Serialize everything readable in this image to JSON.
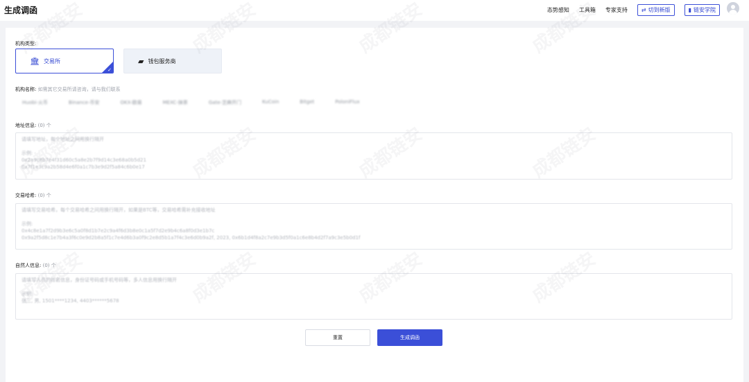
{
  "header": {
    "title": "生成调函",
    "nav": [
      "态势感知",
      "工具箱",
      "专家支持"
    ],
    "pills": [
      {
        "icon": "switch-icon",
        "label": "切到新版"
      },
      {
        "icon": "book-icon",
        "label": "链安学院"
      }
    ]
  },
  "form": {
    "type_label": "机构类型:",
    "type_options": [
      {
        "icon": "bank-icon",
        "label": "交易所",
        "selected": true
      },
      {
        "icon": "wallet-icon",
        "label": "钱包服务商",
        "selected": false
      }
    ],
    "name_label": "机构名称:",
    "name_hint": "如需其它交易所请咨询，请与我们联系",
    "exchanges": [
      "Huobi-火币",
      "Binance-币安",
      "OKX-欧易",
      "MEXC-抹茶",
      "Gate-芝麻开门",
      "KuCoin",
      "Bitget",
      "PoloniFlux"
    ],
    "address": {
      "label": "地址信息:",
      "count": "(0) 个",
      "placeholder": "请填写地址，每个地址之间用换行隔开",
      "example_label": "示例:",
      "example_lines": [
        "0x2a9c8b7e4f31d60c5a8e2b7f9d14c3e68a0b5d21",
        "0x7f1e3c9a2b58d4e6f0a1c7b3e9d2f5a84c6b0e17"
      ]
    },
    "tx": {
      "label": "交易哈希:",
      "count": "(0) 个",
      "placeholder": "请填写交易哈希，每个交易哈希之间用换行隔开，如果是BTC等，交易哈希需补充接收地址",
      "example_label": "示例:",
      "example_lines": [
        "0x4c8e1a7f2d9b3e6c5a0f8d1b7e2c9a4f6d3b8e0c1a5f7d2e9b4c6a8f0d3e1b7c",
        "0x9a2f5d8c1e7b4a3f6c0e9d2b8a5f1c7e4d6b3a0f9c2e8d5b1a7f4c3e6d0b9a2f, 2023, 0x6b1d4f8a2c7e9b3d5f0a1c6e8b4d2f7a9c3e5b0d1f"
      ]
    },
    "person": {
      "label": "自然人信息:",
      "count": "(0) 个",
      "placeholder": "请填写人员的姓名信息，身份证号码或手机号码等，多人信息用换行隔开",
      "example_label": "示例:",
      "example_lines": [
        "张三, 男, 1501****1234, 4403******5678"
      ]
    },
    "buttons": {
      "reset": "重置",
      "generate": "生成调函"
    }
  },
  "watermark": "成都链安"
}
